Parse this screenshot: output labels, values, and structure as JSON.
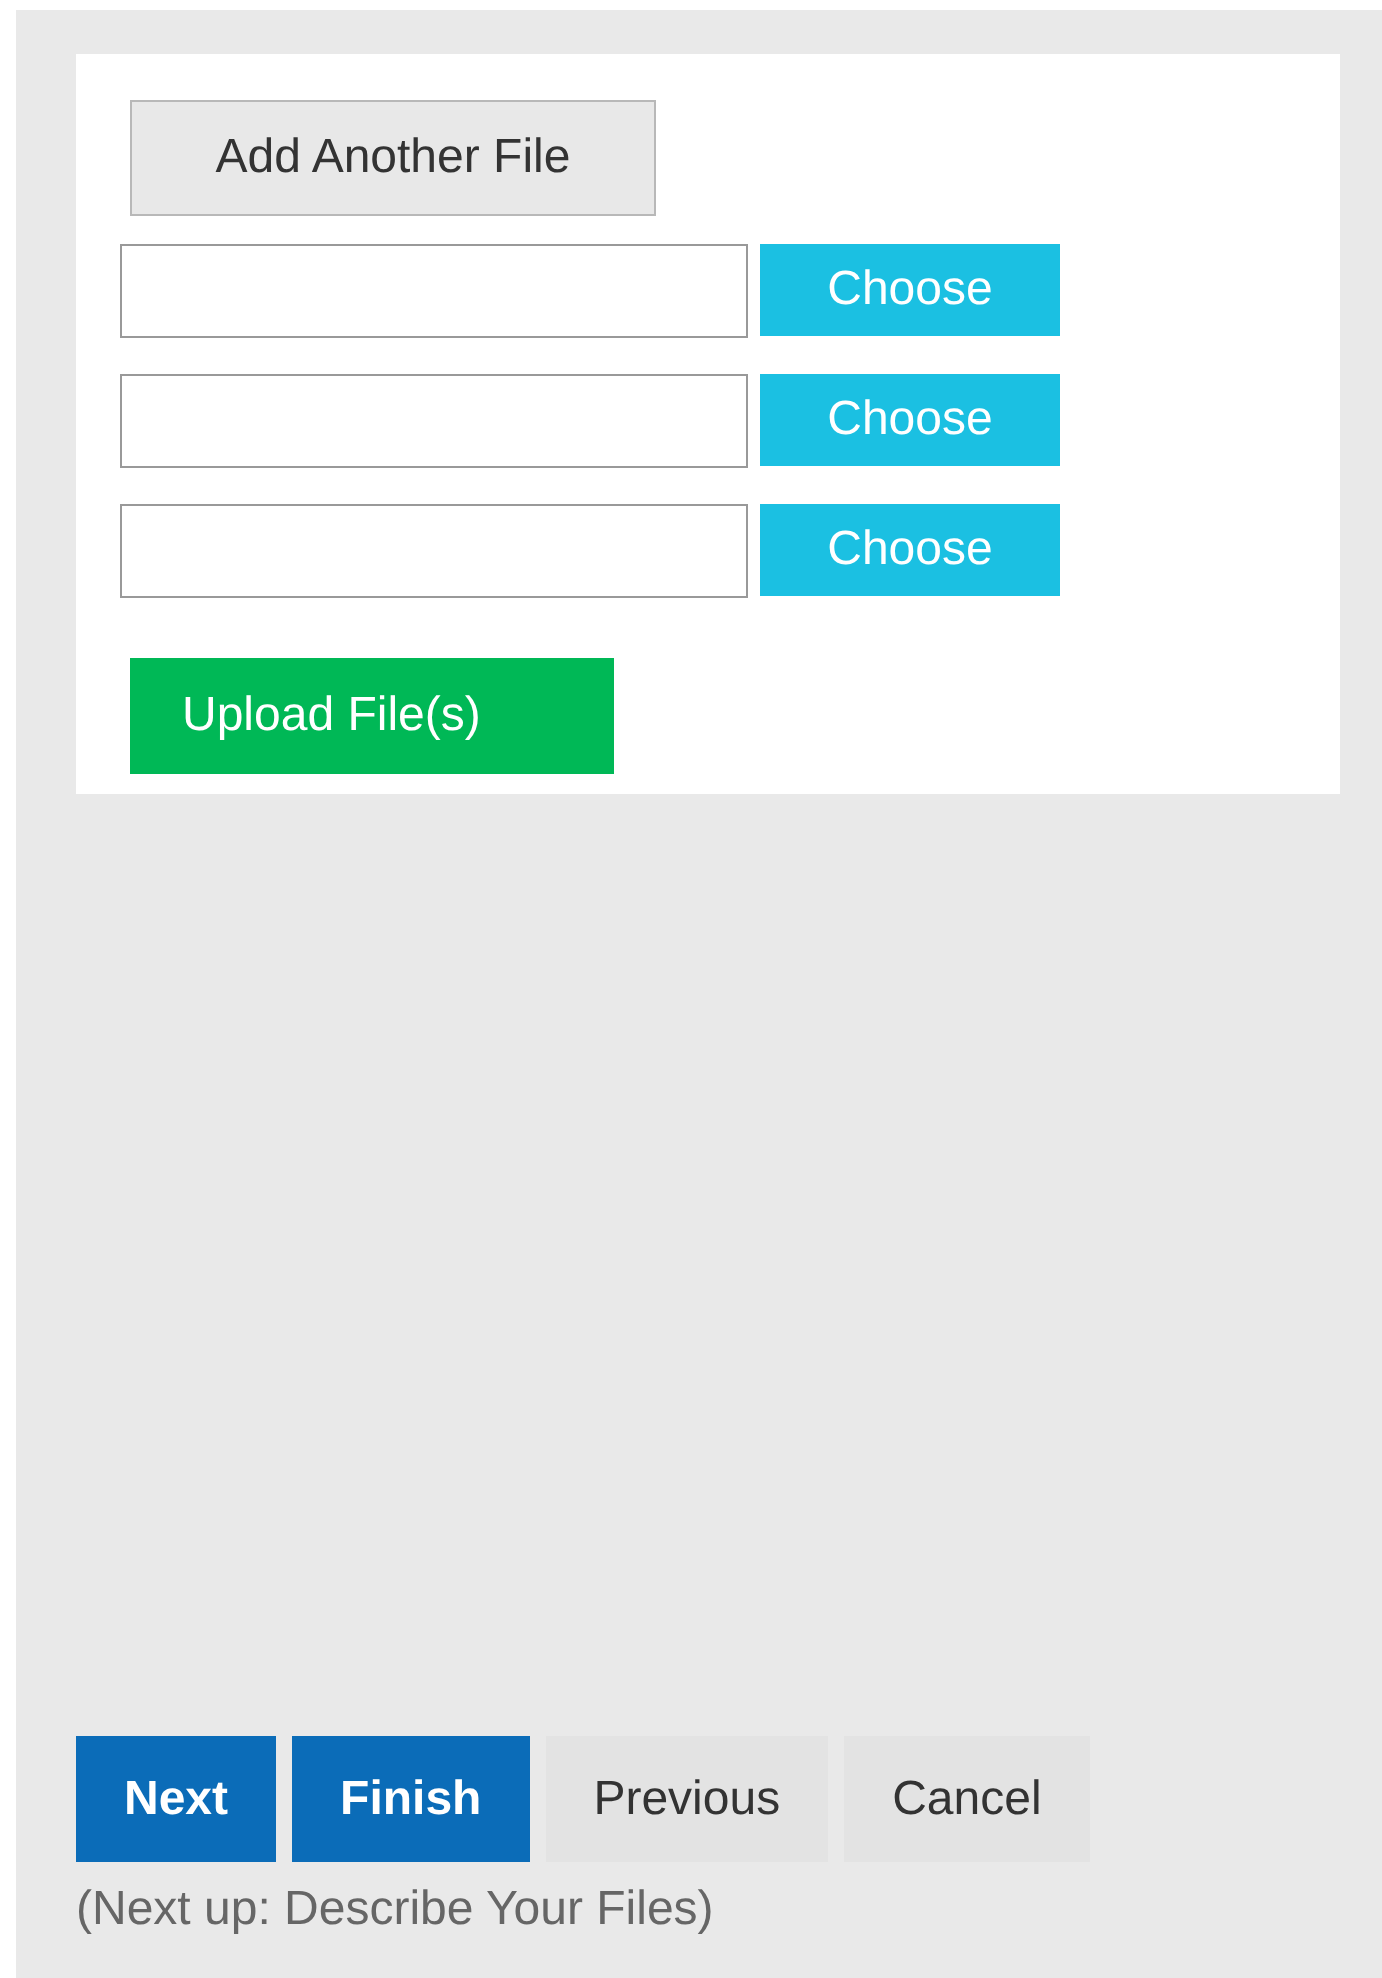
{
  "upload_card": {
    "add_button": "Add Another File",
    "file_rows": [
      {
        "choose_label": "Choose"
      },
      {
        "choose_label": "Choose"
      },
      {
        "choose_label": "Choose"
      }
    ],
    "upload_button": "Upload File(s)"
  },
  "nav_buttons": [
    {
      "label": "Next",
      "kind": "primary"
    },
    {
      "label": "Finish",
      "kind": "primary"
    },
    {
      "label": "Previous",
      "kind": "secondary"
    },
    {
      "label": "Cancel",
      "kind": "secondary"
    }
  ],
  "next_up": "(Next up: Describe Your Files)"
}
